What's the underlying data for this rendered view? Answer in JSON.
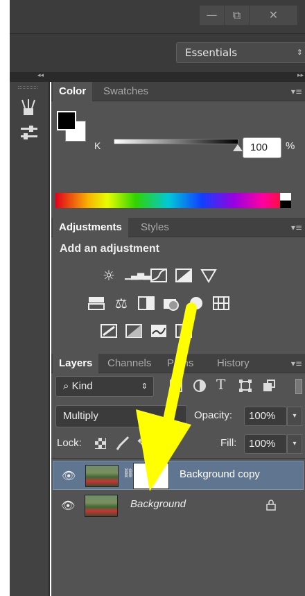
{
  "window": {
    "minimize": "—",
    "restore": "⧉",
    "close": "✕"
  },
  "workspace": {
    "value": "Essentials",
    "arrow": "⇕"
  },
  "collapse": {
    "left": "◂◂",
    "right": "▸▸"
  },
  "color_panel": {
    "tabs": [
      "Color",
      "Swatches"
    ],
    "slider_label": "K",
    "value": "100",
    "unit": "%",
    "foreground": "#000000",
    "background": "#ffffff"
  },
  "adjustments_panel": {
    "tabs": [
      "Adjustments",
      "Styles"
    ],
    "heading": "Add an adjustment",
    "icons": [
      "brightness-icon",
      "levels-icon",
      "curves-icon",
      "exposure-icon",
      "vibrance-icon",
      "hue-saturation-icon",
      "color-balance-icon",
      "black-white-icon",
      "photo-filter-icon",
      "channel-mixer-icon",
      "color-lookup-icon",
      "invert-icon",
      "posterize-icon",
      "threshold-icon",
      "selective-color-icon",
      "gradient-map-icon"
    ]
  },
  "layers_panel": {
    "tabs": [
      "Layers",
      "Channels",
      "Paths",
      "History"
    ],
    "filter": "⌕ Kind",
    "blend_mode": "Multiply",
    "opacity_label": "Opacity:",
    "opacity_value": "100%",
    "lock_label": "Lock:",
    "fill_label": "Fill:",
    "fill_value": "100%",
    "layers": [
      {
        "name": "Background copy",
        "selected": true,
        "has_mask": true
      },
      {
        "name": "Background",
        "selected": false,
        "locked": true
      }
    ]
  },
  "annotation": {
    "color": "#ffff00"
  }
}
